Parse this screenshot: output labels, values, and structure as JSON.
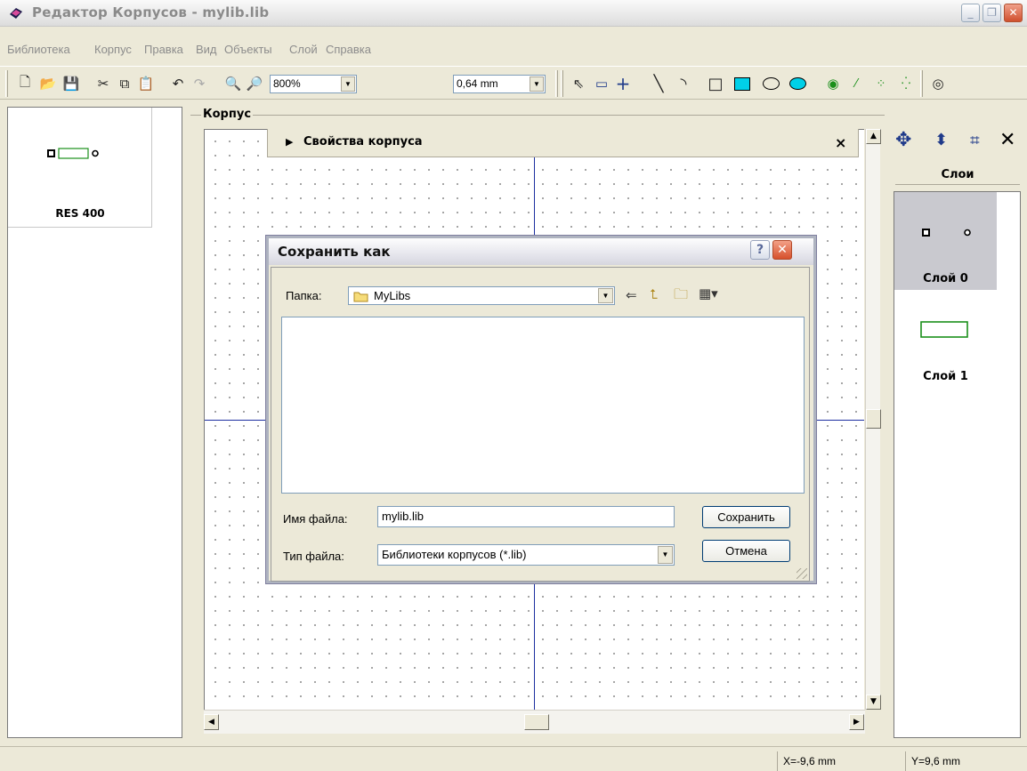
{
  "window": {
    "title": "Редактор Корпусов - mylib.lib",
    "controls": [
      "minimize-icon",
      "restore-icon",
      "close-icon"
    ]
  },
  "menu": {
    "items": [
      "Библиотека",
      "Корпус",
      "Правка",
      "Вид",
      "Объекты",
      "Слой",
      "Справка"
    ]
  },
  "toolbar": {
    "zoom": "800%",
    "grid_step": "0,64 mm",
    "icons": [
      "new-icon",
      "open-icon",
      "save-icon",
      "cut-icon",
      "copy-icon",
      "paste-icon",
      "undo-icon",
      "redo-icon",
      "zoom-in-icon",
      "zoom-out-icon",
      "pointer-icon",
      "ruler-icon",
      "crosshair-icon",
      "line-icon",
      "arc-icon",
      "rectangle-icon",
      "filled-rectangle-icon",
      "ellipse-icon",
      "filled-ellipse-icon",
      "pad-icon",
      "pad-line-icon",
      "pad-array-icon",
      "pad-circle-icon",
      "origin-icon"
    ]
  },
  "library": {
    "parts": [
      {
        "name": "RES 400"
      }
    ]
  },
  "editor": {
    "group_label": "Корпус",
    "properties_panel": "Свойства корпуса"
  },
  "layers": {
    "header": "Слои",
    "items": [
      {
        "name": "Слой 0",
        "selected": true
      },
      {
        "name": "Слой 1",
        "selected": false
      }
    ]
  },
  "status": {
    "x": "X=-9,6 mm",
    "y": "Y=9,6 mm"
  },
  "dialog": {
    "title": "Сохранить как",
    "folder_label": "Папка:",
    "folder_value": "MyLibs",
    "filename_label": "Имя файла:",
    "filename_value": "mylib.lib",
    "filetype_label": "Тип файла:",
    "filetype_value": "Библиотеки корпусов (*.lib)",
    "save_button": "Сохранить",
    "cancel_button": "Отмена",
    "help_button": "?"
  },
  "colors": {
    "axis": "#1c2fa0",
    "pad_outline": "#1a8f1a",
    "selected_layer": "#c9c9cf"
  }
}
